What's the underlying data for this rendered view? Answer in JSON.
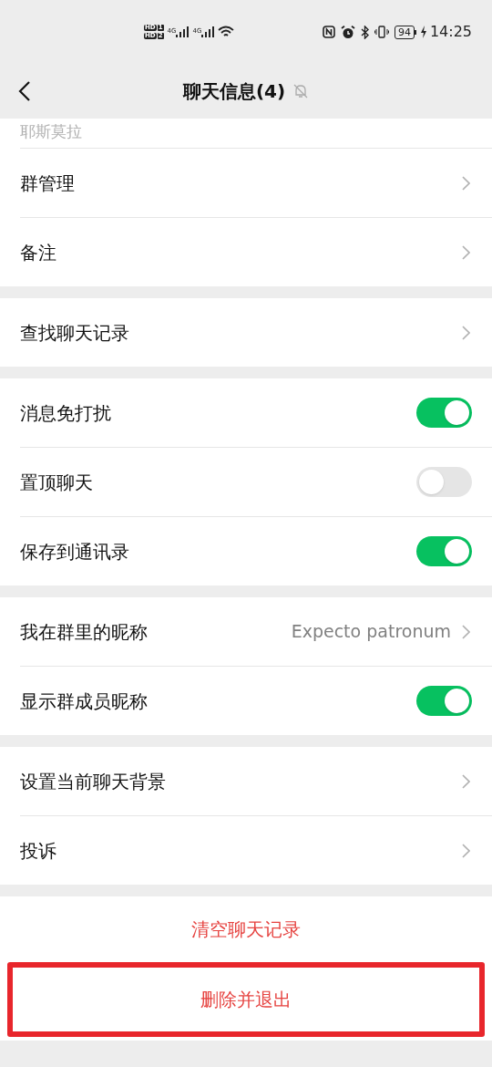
{
  "status_bar": {
    "sim_badges": [
      {
        "hd": "HD",
        "slot": "1"
      },
      {
        "hd": "HD",
        "slot": "2"
      }
    ],
    "network": [
      "4G",
      "4G"
    ],
    "battery": "94",
    "time": "14:25"
  },
  "header": {
    "title": "聊天信息(4)",
    "muted": true
  },
  "groups": [
    {
      "rows": [
        {
          "kind": "caption",
          "label": "耶斯莫拉"
        },
        {
          "kind": "link",
          "label": "群管理"
        },
        {
          "kind": "link",
          "label": "备注"
        }
      ]
    },
    {
      "rows": [
        {
          "kind": "link",
          "label": "查找聊天记录"
        }
      ]
    },
    {
      "rows": [
        {
          "kind": "toggle",
          "label": "消息免打扰",
          "on": true
        },
        {
          "kind": "toggle",
          "label": "置顶聊天",
          "on": false
        },
        {
          "kind": "toggle",
          "label": "保存到通讯录",
          "on": true
        }
      ]
    },
    {
      "rows": [
        {
          "kind": "link",
          "label": "我在群里的昵称",
          "value": "Expecto patronum"
        },
        {
          "kind": "toggle",
          "label": "显示群成员昵称",
          "on": true
        }
      ]
    },
    {
      "rows": [
        {
          "kind": "link",
          "label": "设置当前聊天背景"
        },
        {
          "kind": "link",
          "label": "投诉"
        }
      ]
    }
  ],
  "actions": [
    {
      "label": "清空聊天记录",
      "highlighted": false
    },
    {
      "label": "删除并退出",
      "highlighted": true
    }
  ]
}
